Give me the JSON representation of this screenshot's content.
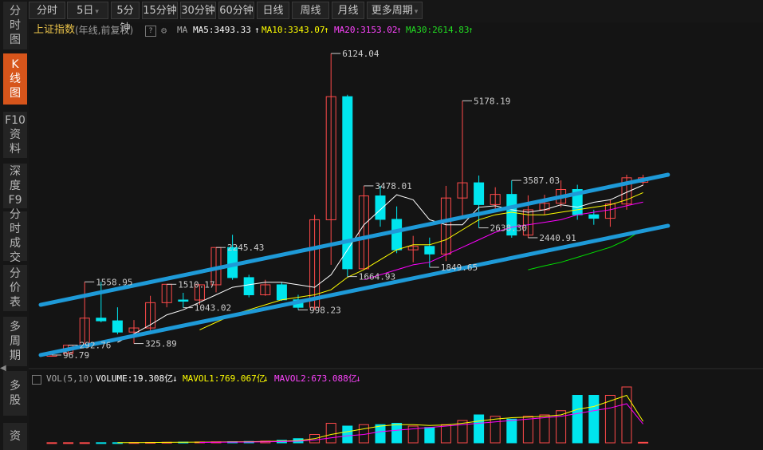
{
  "toolbar": {
    "tabs": [
      "分时",
      "5日",
      "5分钟",
      "15分钟",
      "30分钟",
      "60分钟",
      "日线",
      "周线",
      "月线",
      "更多周期"
    ],
    "dropdown_marker": "▾"
  },
  "sidebar": {
    "items": [
      {
        "label": "分\n时\n图",
        "active": false
      },
      {
        "label": "K\n线\n图",
        "active": true
      },
      {
        "label": "F10\n资\n料",
        "active": false
      },
      {
        "label": "深\n度\nF9",
        "active": false
      },
      {
        "label": "分\n时\n成\n交",
        "active": false
      },
      {
        "label": "分\n价\n表",
        "active": false
      },
      {
        "label": "多\n周\n期",
        "active": false
      },
      {
        "label": "多\n股",
        "active": false
      },
      {
        "label": "资",
        "active": false
      }
    ]
  },
  "header": {
    "index_name": "上证指数",
    "subtitle": "(年线,前复权)",
    "help": "?",
    "ma_label": "MA",
    "ma5": "MA5:3493.33",
    "ma10": "MA10:3343.07",
    "ma20": "MA20:3153.02",
    "ma30": "MA30:2614.83",
    "up_arrow": "↑"
  },
  "volume_header": {
    "label": "VOL(5,10)",
    "volume": "VOLUME:19.308亿",
    "mavol1": "MAVOL1:769.067亿",
    "mavol2": "MAVOL2:673.088亿",
    "down_arrow": "↓"
  },
  "colors": {
    "up": "#ff4a4a",
    "down": "#00e5ee",
    "ma5": "#ffffff",
    "ma10": "#ffff00",
    "ma20": "#ff00ff",
    "ma30": "#00e000",
    "channel": "#1e9ad8",
    "active_tab": "#d7551b",
    "index_name": "#e9c24a",
    "label": "#cccccc"
  },
  "chart_data": {
    "type": "candlestick",
    "title": "上证指数",
    "y_range": [
      0,
      6500
    ],
    "candles": [
      {
        "open": 96.05,
        "close": 96.05,
        "high": 96.05,
        "low": 96.05,
        "up": true
      },
      {
        "open": 127,
        "close": 292.76,
        "high": 292.76,
        "low": 127,
        "up": true
      },
      {
        "open": 292.76,
        "close": 833.8,
        "high": 1558.95,
        "low": 292.76,
        "up": true
      },
      {
        "open": 833.8,
        "close": 780,
        "high": 1558.95,
        "low": 750,
        "up": false
      },
      {
        "open": 780,
        "close": 555,
        "high": 1050,
        "low": 512,
        "up": false
      },
      {
        "open": 555,
        "close": 637,
        "high": 795,
        "low": 325.89,
        "up": true
      },
      {
        "open": 637,
        "close": 1143,
        "high": 1280,
        "low": 512,
        "up": true
      },
      {
        "open": 1143,
        "close": 1510.17,
        "high": 1510.17,
        "low": 1050,
        "up": true
      },
      {
        "open": 1196,
        "close": 1196,
        "high": 1340,
        "low": 1043.02,
        "up": false
      },
      {
        "open": 1196,
        "close": 1500,
        "high": 1510.17,
        "low": 1100,
        "up": true
      },
      {
        "open": 1500,
        "close": 2245.43,
        "high": 2245.43,
        "low": 1350,
        "up": true
      },
      {
        "open": 2245.43,
        "close": 1644,
        "high": 2500,
        "low": 1600,
        "up": false
      },
      {
        "open": 1644,
        "close": 1300,
        "high": 1700,
        "low": 1250,
        "up": false
      },
      {
        "open": 1300,
        "close": 1500,
        "high": 1600,
        "low": 1280,
        "up": true
      },
      {
        "open": 1500,
        "close": 1200,
        "high": 1550,
        "low": 1180,
        "up": false
      },
      {
        "open": 1200,
        "close": 1050,
        "high": 1300,
        "low": 998.23,
        "up": false
      },
      {
        "open": 1050,
        "close": 2800,
        "high": 2900,
        "low": 998.23,
        "up": true
      },
      {
        "open": 2800,
        "close": 5261,
        "high": 6124.04,
        "low": 1900,
        "up": true
      },
      {
        "open": 5261,
        "close": 1820,
        "high": 5300,
        "low": 1664.93,
        "up": false
      },
      {
        "open": 1820,
        "close": 3277,
        "high": 3478.01,
        "low": 1800,
        "up": true
      },
      {
        "open": 3277,
        "close": 2808,
        "high": 3478.01,
        "low": 2661,
        "up": false
      },
      {
        "open": 2808,
        "close": 2199,
        "high": 3067,
        "low": 2132,
        "up": false
      },
      {
        "open": 2199,
        "close": 2269,
        "high": 2478,
        "low": 1949,
        "up": true
      },
      {
        "open": 2269,
        "close": 2116,
        "high": 2444,
        "low": 1849.65,
        "up": false
      },
      {
        "open": 2116,
        "close": 3235,
        "high": 3478,
        "low": 1974,
        "up": true
      },
      {
        "open": 3235,
        "close": 3539,
        "high": 5178.19,
        "low": 2850,
        "up": true
      },
      {
        "open": 3539,
        "close": 3104,
        "high": 3684,
        "low": 2638.3,
        "up": false
      },
      {
        "open": 3104,
        "close": 3307,
        "high": 3450,
        "low": 3005,
        "up": true
      },
      {
        "open": 3307,
        "close": 2494,
        "high": 3587.03,
        "low": 2440.91,
        "up": false
      },
      {
        "open": 2494,
        "close": 2999,
        "high": 3288,
        "low": 2440.91,
        "up": true
      },
      {
        "open": 2999,
        "close": 3130,
        "high": 3300,
        "low": 2900,
        "up": true
      },
      {
        "open": 3130,
        "close": 3405,
        "high": 3587,
        "low": 3053,
        "up": true
      },
      {
        "open": 3405,
        "close": 2900,
        "high": 3500,
        "low": 2800,
        "up": false
      },
      {
        "open": 2900,
        "close": 2830,
        "high": 3000,
        "low": 2700,
        "up": false
      },
      {
        "open": 2830,
        "close": 3115,
        "high": 3200,
        "low": 2660,
        "up": true
      },
      {
        "open": 3115,
        "close": 3639,
        "high": 3700,
        "low": 3000,
        "up": true
      },
      {
        "open": 3639,
        "close": 3550,
        "high": 3700,
        "low": 3500,
        "up": true
      }
    ],
    "ma5": [
      null,
      null,
      null,
      null,
      350,
      520,
      700,
      900,
      1000,
      1150,
      1300,
      1450,
      1500,
      1550,
      1550,
      1500,
      1450,
      1700,
      2200,
      2700,
      3000,
      3300,
      3200,
      2800,
      2700,
      2700,
      3050,
      3080,
      3000,
      2950,
      3000,
      3100,
      3050,
      3150,
      3200,
      3350,
      3493.33
    ],
    "ma10": [
      null,
      null,
      null,
      null,
      null,
      null,
      null,
      null,
      null,
      600,
      750,
      900,
      1000,
      1100,
      1200,
      1250,
      1300,
      1400,
      1650,
      1800,
      2000,
      2200,
      2300,
      2300,
      2400,
      2600,
      2800,
      2900,
      2950,
      2900,
      2900,
      2950,
      3000,
      3050,
      3100,
      3200,
      3343.07
    ],
    "ma20": [
      null,
      null,
      null,
      null,
      null,
      null,
      null,
      null,
      null,
      null,
      null,
      null,
      null,
      null,
      null,
      null,
      null,
      null,
      null,
      1600,
      1700,
      1800,
      1900,
      1950,
      2100,
      2250,
      2400,
      2550,
      2650,
      2700,
      2750,
      2800,
      2900,
      2950,
      3000,
      3080,
      3153.02
    ],
    "ma30": [
      null,
      null,
      null,
      null,
      null,
      null,
      null,
      null,
      null,
      null,
      null,
      null,
      null,
      null,
      null,
      null,
      null,
      null,
      null,
      null,
      null,
      null,
      null,
      null,
      null,
      null,
      null,
      null,
      null,
      1800,
      1880,
      1950,
      2050,
      2150,
      2250,
      2400,
      2614.83
    ],
    "labels": [
      {
        "i": 0,
        "value": 96.05,
        "text": "96.79",
        "side": "right"
      },
      {
        "i": 1,
        "value": 292.76,
        "text": "292.76",
        "side": "right"
      },
      {
        "i": 2,
        "value": 1558.95,
        "text": "1558.95",
        "side": "right"
      },
      {
        "i": 5,
        "value": 325.89,
        "text": "325.89",
        "side": "right"
      },
      {
        "i": 7,
        "value": 1510.17,
        "text": "1510.17",
        "side": "right"
      },
      {
        "i": 8,
        "value": 1043.02,
        "text": "1043.02",
        "side": "right"
      },
      {
        "i": 10,
        "value": 2245.43,
        "text": "2245.43",
        "side": "right"
      },
      {
        "i": 15,
        "value": 998.23,
        "text": "998.23",
        "side": "right"
      },
      {
        "i": 17,
        "value": 6124.04,
        "text": "6124.04",
        "side": "right"
      },
      {
        "i": 18,
        "value": 1664.93,
        "text": "1664.93",
        "side": "right"
      },
      {
        "i": 19,
        "value": 3478.01,
        "text": "3478.01",
        "side": "right"
      },
      {
        "i": 23,
        "value": 1849.65,
        "text": "1849.65",
        "side": "right"
      },
      {
        "i": 25,
        "value": 5178.19,
        "text": "5178.19",
        "side": "right"
      },
      {
        "i": 26,
        "value": 2638.3,
        "text": "2638.30",
        "side": "right"
      },
      {
        "i": 28,
        "value": 3587.03,
        "text": "3587.03",
        "side": "right"
      },
      {
        "i": 29,
        "value": 2440.91,
        "text": "2440.91",
        "side": "right"
      }
    ],
    "channel_lines": [
      {
        "from_i": 0,
        "from_value": 1100,
        "to_i": 38,
        "to_value": 3700
      },
      {
        "from_i": 0,
        "from_value": 96,
        "to_i": 38,
        "to_value": 2680
      }
    ],
    "volume": {
      "y_range": [
        0,
        2600
      ],
      "values": [
        5,
        5,
        5,
        5,
        5,
        10,
        15,
        20,
        25,
        30,
        35,
        40,
        50,
        60,
        90,
        150,
        300,
        700,
        600,
        650,
        650,
        700,
        600,
        550,
        650,
        800,
        1000,
        950,
        850,
        950,
        1000,
        1150,
        1700,
        1700,
        1700,
        2000,
        19.308
      ],
      "up": [
        true,
        true,
        true,
        false,
        false,
        true,
        true,
        true,
        false,
        true,
        true,
        false,
        false,
        true,
        false,
        false,
        true,
        true,
        false,
        true,
        false,
        false,
        true,
        false,
        true,
        true,
        false,
        true,
        false,
        true,
        true,
        true,
        false,
        false,
        true,
        true,
        true
      ],
      "mavol1": [
        null,
        null,
        null,
        null,
        5,
        8,
        12,
        16,
        20,
        25,
        30,
        35,
        40,
        50,
        60,
        80,
        150,
        300,
        400,
        500,
        600,
        650,
        650,
        620,
        640,
        700,
        780,
        850,
        900,
        920,
        950,
        1000,
        1200,
        1300,
        1500,
        1700,
        769.067
      ],
      "mavol2": [
        null,
        null,
        null,
        null,
        null,
        null,
        null,
        null,
        null,
        15,
        20,
        25,
        30,
        35,
        45,
        60,
        100,
        180,
        250,
        300,
        400,
        450,
        500,
        550,
        600,
        650,
        700,
        750,
        800,
        850,
        900,
        950,
        1050,
        1150,
        1250,
        1400,
        673.088
      ]
    }
  }
}
